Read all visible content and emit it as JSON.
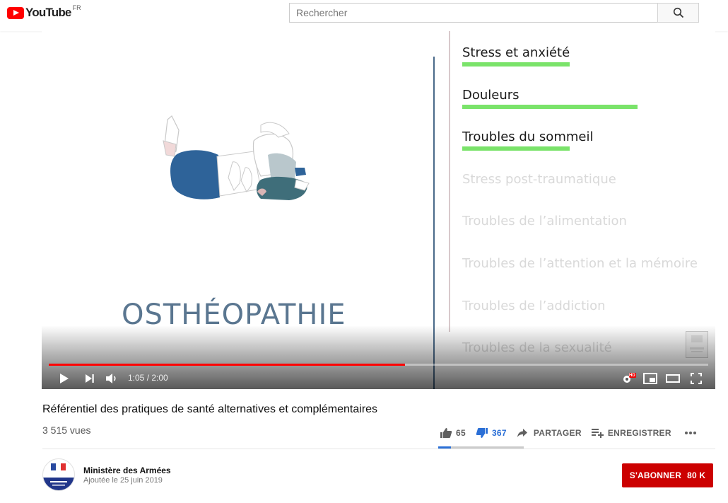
{
  "header": {
    "logo_text": "YouTube",
    "region": "FR",
    "search_placeholder": "Rechercher"
  },
  "video": {
    "headline": "OSTHÉOPATHIE",
    "topics": [
      {
        "label": "Stress et anxiété",
        "state": "active",
        "level": 0.55
      },
      {
        "label": "Douleurs",
        "state": "active",
        "level": 0.9
      },
      {
        "label": "Troubles du sommeil",
        "state": "active",
        "level": 0.55
      },
      {
        "label": "Stress post-traumatique",
        "state": "faded"
      },
      {
        "label": "Troubles de l’alimentation",
        "state": "faded"
      },
      {
        "label": "Troubles de l’attention et la mémoire",
        "state": "faded"
      },
      {
        "label": "Troubles de l’addiction",
        "state": "faded"
      },
      {
        "label": "Troubles de la sexualité",
        "state": "faded"
      }
    ],
    "progress": 0.54,
    "time": "1:05 / 2:00",
    "hd_badge": "HD"
  },
  "info": {
    "title": "Référentiel des pratiques de santé alternatives et complémentaires",
    "views": "3 515 vues",
    "likes": "65",
    "dislikes": "367",
    "share_label": "PARTAGER",
    "save_label": "ENREGISTRER",
    "like_ratio": 0.15
  },
  "channel": {
    "name": "Ministère des Armées",
    "published": "Ajoutée le 25 juin 2019",
    "subscribe_label": "S'ABONNER",
    "subscriber_count": "80 K"
  },
  "colors": {
    "brand_red": "#ff0000",
    "subscribe_red": "#cc0000",
    "topic_bar": "#7ae36a",
    "dislike_blue": "#2b6fd6"
  }
}
